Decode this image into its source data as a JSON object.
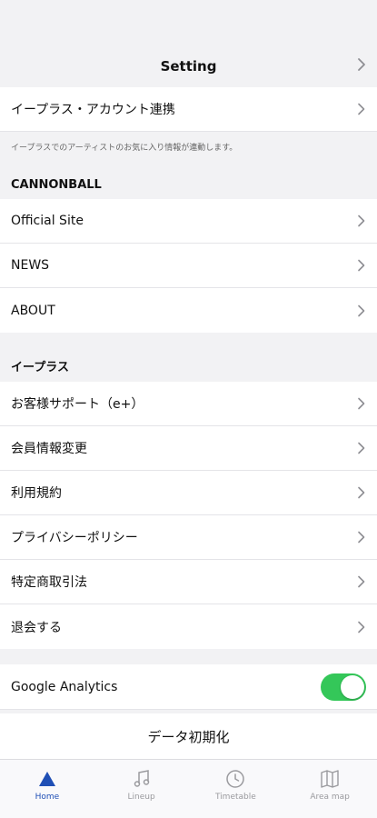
{
  "header": {
    "title": "Setting"
  },
  "account": {
    "label": "イープラス・アカウント連携",
    "note": "イープラスでのアーティストのお気に入り情報が連動します。"
  },
  "section_cannonball": {
    "title": "CANNONBALL",
    "items": [
      {
        "label": "Official Site"
      },
      {
        "label": "NEWS"
      },
      {
        "label": "ABOUT"
      }
    ]
  },
  "section_eplus": {
    "title": "イープラス",
    "items": [
      {
        "label": "お客様サポート（e+）"
      },
      {
        "label": "会員情報変更"
      },
      {
        "label": "利用規約"
      },
      {
        "label": "プライバシーポリシー"
      },
      {
        "label": "特定商取引法"
      },
      {
        "label": "退会する"
      }
    ]
  },
  "analytics": {
    "label": "Google Analytics",
    "enabled": true
  },
  "reset": {
    "label": "データ初期化"
  },
  "tabs": [
    {
      "label": "Home",
      "icon": "home-icon",
      "active": true
    },
    {
      "label": "Lineup",
      "icon": "music-note-icon",
      "active": false
    },
    {
      "label": "Timetable",
      "icon": "clock-icon",
      "active": false
    },
    {
      "label": "Area map",
      "icon": "map-icon",
      "active": false
    }
  ],
  "colors": {
    "accent": "#1f4fb5",
    "toggle_on": "#34c759",
    "tab_inactive": "#9a9a9e"
  }
}
